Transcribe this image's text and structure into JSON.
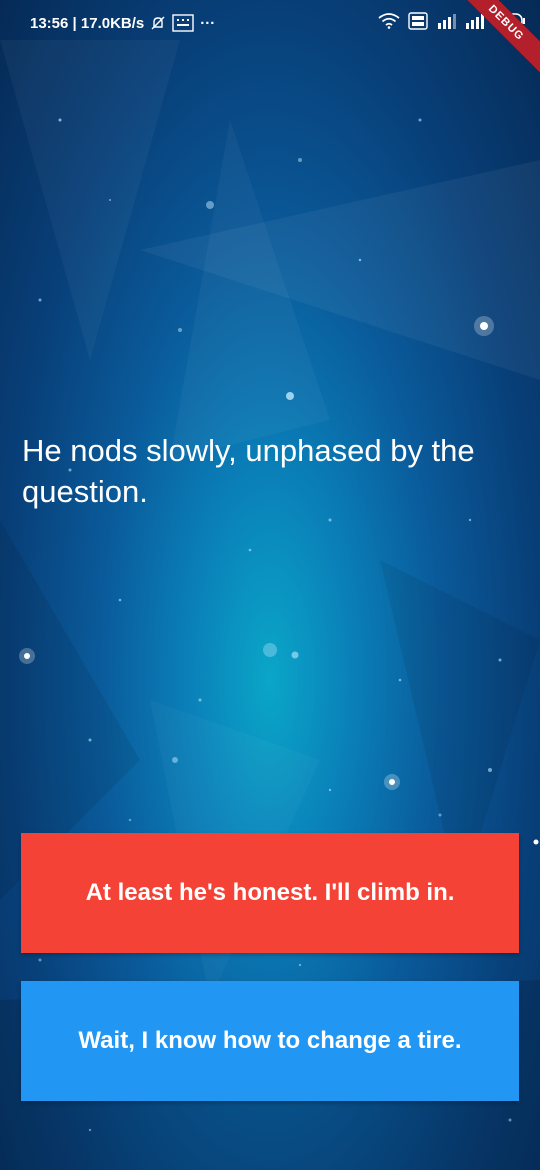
{
  "status_bar": {
    "time_speed": "13:56 | 17.0KB/s",
    "more": "···",
    "network_label": "4G",
    "volte_label": "Vo LTE",
    "battery": "65",
    "debug_ribbon": "DEBUG"
  },
  "icons": {
    "mute": "bell-off-icon",
    "keyboard": "keyboard-icon",
    "wifi": "wifi-icon",
    "volte": "volte-icon",
    "signal": "signal-icon",
    "battery": "battery-icon"
  },
  "story": {
    "text": "He nods slowly, unphased by the question."
  },
  "choices": [
    {
      "label": "At least he's honest. I'll climb in.",
      "color": "#f44336"
    },
    {
      "label": "Wait, I know how to change a tire.",
      "color": "#2196f3"
    }
  ],
  "colors": {
    "background_center": "#0aa6c8",
    "background_edge": "#062a56",
    "text": "#ffffff",
    "debug_ribbon": "#b31f2a"
  }
}
